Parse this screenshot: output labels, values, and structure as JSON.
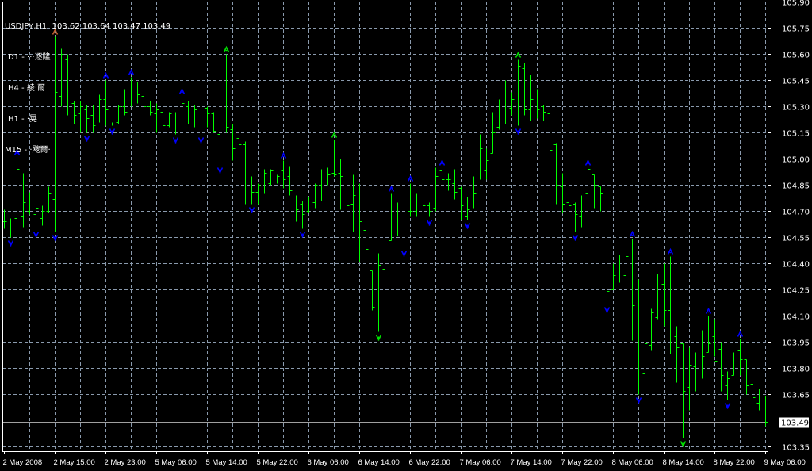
{
  "header": {
    "symbol": "USDJPY,H1",
    "ohlc": "103.62 103.64 103.47 103.49"
  },
  "indicators": [
    {
      "label": "D1 - ···逐隆"
    },
    {
      "label": "H4 - 綾·爾"
    },
    {
      "label": "H1 - ·晃"
    },
    {
      "label": "M15 - ·飕爾·"
    }
  ],
  "colors": {
    "background": "#000000",
    "bars": "#00ff00",
    "grid": "#8a9aad",
    "fractal_up": "#0000ff",
    "fractal_down": "#0000ff",
    "signal_green": "#00e000",
    "signal_orange": "#c06030",
    "axis": "#ffffff"
  },
  "chart_data": {
    "type": "ohlc",
    "symbol": "USDJPY",
    "timeframe": "H1",
    "ylim": [
      103.35,
      105.9
    ],
    "y_ticks": [
      "105.90",
      "105.75",
      "105.60",
      "105.45",
      "105.30",
      "105.15",
      "105.00",
      "104.85",
      "104.70",
      "104.55",
      "104.40",
      "104.25",
      "104.10",
      "103.95",
      "103.80",
      "103.65",
      "103.35"
    ],
    "current_price": "103.49",
    "x_ticks": [
      {
        "bar": 0,
        "label": "2 May 2008"
      },
      {
        "bar": 8,
        "label": "2 May 15:00"
      },
      {
        "bar": 16,
        "label": "2 May 23:00"
      },
      {
        "bar": 24,
        "label": "5 May 06:00"
      },
      {
        "bar": 32,
        "label": "5 May 14:00"
      },
      {
        "bar": 40,
        "label": "5 May 22:00"
      },
      {
        "bar": 48,
        "label": "6 May 06:00"
      },
      {
        "bar": 56,
        "label": "6 May 14:00"
      },
      {
        "bar": 64,
        "label": "6 May 22:00"
      },
      {
        "bar": 72,
        "label": "7 May 06:00"
      },
      {
        "bar": 80,
        "label": "7 May 14:00"
      },
      {
        "bar": 88,
        "label": "7 May 22:00"
      },
      {
        "bar": 96,
        "label": "8 May 06:00"
      },
      {
        "bar": 104,
        "label": "8 May 14:00"
      },
      {
        "bar": 112,
        "label": "8 May 22:00"
      },
      {
        "bar": 120,
        "label": "9 May 06:00"
      }
    ],
    "bars_ohlc": [
      [
        104.64,
        104.71,
        104.6,
        104.64
      ],
      [
        104.58,
        104.66,
        104.55,
        104.65
      ],
      [
        104.66,
        105.01,
        104.65,
        104.94
      ],
      [
        104.67,
        104.92,
        104.61,
        104.75
      ],
      [
        104.7,
        104.81,
        104.68,
        104.76
      ],
      [
        104.68,
        104.79,
        104.6,
        104.72
      ],
      [
        104.66,
        104.73,
        104.62,
        104.7
      ],
      [
        104.7,
        104.84,
        104.69,
        104.8
      ],
      [
        104.77,
        105.7,
        104.58,
        105.38
      ],
      [
        105.36,
        105.63,
        105.3,
        105.6
      ],
      [
        105.57,
        105.6,
        105.25,
        105.33
      ],
      [
        105.32,
        105.33,
        105.2,
        105.25
      ],
      [
        105.26,
        105.33,
        105.15,
        105.3
      ],
      [
        105.28,
        105.31,
        105.15,
        105.23
      ],
      [
        105.25,
        105.31,
        105.15,
        105.19
      ],
      [
        105.22,
        105.37,
        105.21,
        105.34
      ],
      [
        105.34,
        105.45,
        105.19,
        105.28
      ],
      [
        105.2,
        105.21,
        105.19,
        105.2
      ],
      [
        105.21,
        105.31,
        105.2,
        105.3
      ],
      [
        105.3,
        105.4,
        105.25,
        105.27
      ],
      [
        105.31,
        105.47,
        105.3,
        105.44
      ],
      [
        105.44,
        105.44,
        105.32,
        105.37
      ],
      [
        105.36,
        105.43,
        105.25,
        105.3
      ],
      [
        105.3,
        105.33,
        105.25,
        105.27
      ],
      [
        105.26,
        105.32,
        105.15,
        105.28
      ],
      [
        105.27,
        105.27,
        105.17,
        105.19
      ],
      [
        105.19,
        105.27,
        105.18,
        105.26
      ],
      [
        105.24,
        105.27,
        105.14,
        105.22
      ],
      [
        105.22,
        105.36,
        105.2,
        105.32
      ],
      [
        105.3,
        105.33,
        105.2,
        105.22
      ],
      [
        105.22,
        105.31,
        105.18,
        105.28
      ],
      [
        105.24,
        105.27,
        105.14,
        105.2
      ],
      [
        105.29,
        105.3,
        105.18,
        105.26
      ],
      [
        105.26,
        105.27,
        105.15,
        105.16
      ],
      [
        105.14,
        105.25,
        104.97,
        105.22
      ],
      [
        105.22,
        105.6,
        105.15,
        105.18
      ],
      [
        105.17,
        105.2,
        104.99,
        105.06
      ],
      [
        105.12,
        105.19,
        105.04,
        105.08
      ],
      [
        105.08,
        105.1,
        104.74,
        104.76
      ],
      [
        104.78,
        104.9,
        104.74,
        104.81
      ],
      [
        104.81,
        104.86,
        104.74,
        104.85
      ],
      [
        104.87,
        104.94,
        104.8,
        104.92
      ],
      [
        104.86,
        104.94,
        104.85,
        104.93
      ],
      [
        104.89,
        104.91,
        104.86,
        104.9
      ],
      [
        104.93,
        104.99,
        104.83,
        104.88
      ],
      [
        104.9,
        104.96,
        104.79,
        104.82
      ],
      [
        104.78,
        104.79,
        104.64,
        104.71
      ],
      [
        104.74,
        104.76,
        104.6,
        104.68
      ],
      [
        104.7,
        104.78,
        104.69,
        104.76
      ],
      [
        104.75,
        104.86,
        104.72,
        104.85
      ],
      [
        104.85,
        104.94,
        104.76,
        104.89
      ],
      [
        104.89,
        104.95,
        104.85,
        104.91
      ],
      [
        104.92,
        105.11,
        104.9,
        104.91
      ],
      [
        104.92,
        105.0,
        104.71,
        104.9
      ],
      [
        104.76,
        104.8,
        104.63,
        104.73
      ],
      [
        104.74,
        104.91,
        104.58,
        104.79
      ],
      [
        104.78,
        104.86,
        104.41,
        104.64
      ],
      [
        104.59,
        104.59,
        104.35,
        104.48
      ],
      [
        104.36,
        104.36,
        104.13,
        104.15
      ],
      [
        104.17,
        104.46,
        104.01,
        104.39
      ],
      [
        104.37,
        104.54,
        104.35,
        104.52
      ],
      [
        104.53,
        104.8,
        104.53,
        104.76
      ],
      [
        104.76,
        104.75,
        104.56,
        104.65
      ],
      [
        104.58,
        104.71,
        104.49,
        104.69
      ],
      [
        104.7,
        104.86,
        104.67,
        104.7
      ],
      [
        104.7,
        104.8,
        104.67,
        104.76
      ],
      [
        104.76,
        104.79,
        104.72,
        104.73
      ],
      [
        104.73,
        104.75,
        104.67,
        104.7
      ],
      [
        104.72,
        104.95,
        104.7,
        104.9
      ],
      [
        104.93,
        104.95,
        104.83,
        104.88
      ],
      [
        104.88,
        104.92,
        104.82,
        104.88
      ],
      [
        104.86,
        104.94,
        104.77,
        104.81
      ],
      [
        104.83,
        104.84,
        104.65,
        104.73
      ],
      [
        104.67,
        104.78,
        104.65,
        104.71
      ],
      [
        104.78,
        104.9,
        104.72,
        104.8
      ],
      [
        104.89,
        105.14,
        104.88,
        105.06
      ],
      [
        104.93,
        105.06,
        104.88,
        104.99
      ],
      [
        105.03,
        105.27,
        105.03,
        105.15
      ],
      [
        105.18,
        105.34,
        105.17,
        105.22
      ],
      [
        105.2,
        105.45,
        105.2,
        105.33
      ],
      [
        105.29,
        105.38,
        105.25,
        105.34
      ],
      [
        105.33,
        105.57,
        105.19,
        105.53
      ],
      [
        105.52,
        105.55,
        105.25,
        105.28
      ],
      [
        105.28,
        105.48,
        105.22,
        105.34
      ],
      [
        105.35,
        105.4,
        105.23,
        105.28
      ],
      [
        105.3,
        105.31,
        105.22,
        105.27
      ],
      [
        105.26,
        105.27,
        105.02,
        105.05
      ],
      [
        105.08,
        105.09,
        104.74,
        104.85
      ],
      [
        104.84,
        104.92,
        104.69,
        104.74
      ],
      [
        104.75,
        104.76,
        104.61,
        104.73
      ],
      [
        104.74,
        104.75,
        104.58,
        104.68
      ],
      [
        104.67,
        104.79,
        104.61,
        104.78
      ],
      [
        104.8,
        104.95,
        104.76,
        104.94
      ],
      [
        104.91,
        104.91,
        104.72,
        104.85
      ],
      [
        104.84,
        104.84,
        104.7,
        104.8
      ],
      [
        104.78,
        104.8,
        104.17,
        104.24
      ],
      [
        104.25,
        104.4,
        104.25,
        104.33
      ],
      [
        104.3,
        104.45,
        104.29,
        104.32
      ],
      [
        104.33,
        104.45,
        104.31,
        104.44
      ],
      [
        104.45,
        104.54,
        103.96,
        104.16
      ],
      [
        104.17,
        104.31,
        103.65,
        103.79
      ],
      [
        103.77,
        103.94,
        103.74,
        103.94
      ],
      [
        103.93,
        104.14,
        103.9,
        104.12
      ],
      [
        104.09,
        104.34,
        104.08,
        104.23
      ],
      [
        104.28,
        104.4,
        104.04,
        104.13
      ],
      [
        104.13,
        104.44,
        103.88,
        103.97
      ],
      [
        103.98,
        104.04,
        103.72,
        103.92
      ],
      [
        103.94,
        103.94,
        103.4,
        103.67
      ],
      [
        103.69,
        103.92,
        103.56,
        103.82
      ],
      [
        103.81,
        103.89,
        103.67,
        103.79
      ],
      [
        103.75,
        104.02,
        103.74,
        103.87
      ],
      [
        103.89,
        104.1,
        103.89,
        103.94
      ],
      [
        103.98,
        104.08,
        103.87,
        103.84
      ],
      [
        103.91,
        103.95,
        103.67,
        103.76
      ],
      [
        103.7,
        103.78,
        103.62,
        103.74
      ],
      [
        103.76,
        103.89,
        103.76,
        103.88
      ],
      [
        103.9,
        103.97,
        103.76,
        103.85
      ],
      [
        103.85,
        103.85,
        103.65,
        103.7
      ],
      [
        103.71,
        103.78,
        103.49,
        103.63
      ],
      [
        103.6,
        103.68,
        103.56,
        103.64
      ],
      [
        103.62,
        103.64,
        103.47,
        103.49
      ]
    ],
    "fractals_up": [
      2,
      16,
      20,
      28,
      44,
      61,
      64,
      69,
      92,
      99,
      105,
      111,
      116
    ],
    "fractals_down": [
      1,
      5,
      8,
      13,
      17,
      27,
      31,
      34,
      39,
      47,
      63,
      67,
      73,
      81,
      90,
      95,
      100,
      114
    ],
    "signals_up_green": [
      35,
      52,
      81
    ],
    "signals_up_orange": [
      8
    ],
    "signals_down_green": [
      59,
      107
    ],
    "grid": true
  }
}
